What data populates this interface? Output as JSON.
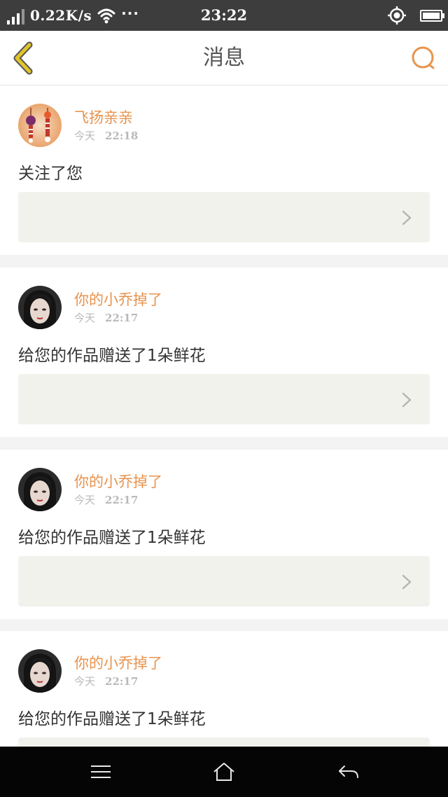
{
  "status_bar": {
    "network_speed": "0.22K/s",
    "more_indicator": "···",
    "time": "23:22",
    "icons": [
      "signal-icon",
      "wifi-icon",
      "location-icon",
      "battery-icon"
    ]
  },
  "header": {
    "title": "消息",
    "back_icon": "chevron-left-icon",
    "search_icon": "search-icon"
  },
  "colors": {
    "accent": "#e8934e",
    "back_icon": "#e0c42a",
    "work_box_bg": "#f2f2ed",
    "status_bar_bg": "#3d3d3d",
    "nav_bar_bg": "#050505"
  },
  "messages": [
    {
      "username": "飞扬亲亲",
      "day": "今天",
      "time": "22:18",
      "text": "关注了您",
      "avatar": "avatar-decorations"
    },
    {
      "username": "你的小乔掉了",
      "day": "今天",
      "time": "22:17",
      "text": "给您的作品赠送了1朵鲜花",
      "avatar": "avatar-portrait"
    },
    {
      "username": "你的小乔掉了",
      "day": "今天",
      "time": "22:17",
      "text": "给您的作品赠送了1朵鲜花",
      "avatar": "avatar-portrait"
    },
    {
      "username": "你的小乔掉了",
      "day": "今天",
      "time": "22:17",
      "text": "给您的作品赠送了1朵鲜花",
      "avatar": "avatar-portrait"
    }
  ],
  "nav_bar": {
    "icons": [
      "menu-icon",
      "home-icon",
      "back-arrow-icon"
    ]
  }
}
